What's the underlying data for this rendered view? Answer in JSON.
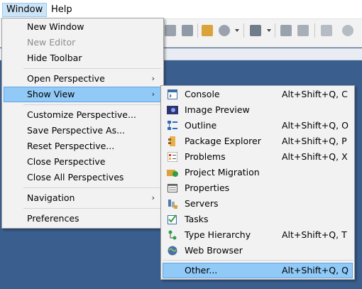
{
  "menubar": {
    "window": "Window",
    "help": "Help"
  },
  "window_menu": {
    "group1": [
      "New Window",
      "New Editor",
      "Hide Toolbar"
    ],
    "open_perspective": "Open Perspective",
    "show_view": "Show View",
    "group3": [
      "Customize Perspective...",
      "Save Perspective As...",
      "Reset Perspective...",
      "Close Perspective",
      "Close All Perspectives"
    ],
    "navigation": "Navigation",
    "preferences": "Preferences",
    "arrow": "›"
  },
  "show_view_menu": {
    "items": [
      {
        "label": "Console",
        "shortcut": "Alt+Shift+Q, C",
        "icon": "console-icon"
      },
      {
        "label": "Image Preview",
        "shortcut": "",
        "icon": "image-preview-icon"
      },
      {
        "label": "Outline",
        "shortcut": "Alt+Shift+Q, O",
        "icon": "outline-icon"
      },
      {
        "label": "Package Explorer",
        "shortcut": "Alt+Shift+Q, P",
        "icon": "package-explorer-icon"
      },
      {
        "label": "Problems",
        "shortcut": "Alt+Shift+Q, X",
        "icon": "problems-icon"
      },
      {
        "label": "Project Migration",
        "shortcut": "",
        "icon": "project-migration-icon"
      },
      {
        "label": "Properties",
        "shortcut": "",
        "icon": "properties-icon"
      },
      {
        "label": "Servers",
        "shortcut": "",
        "icon": "servers-icon"
      },
      {
        "label": "Tasks",
        "shortcut": "",
        "icon": "tasks-icon"
      },
      {
        "label": "Type Hierarchy",
        "shortcut": "Alt+Shift+Q, T",
        "icon": "type-hierarchy-icon"
      },
      {
        "label": "Web Browser",
        "shortcut": "",
        "icon": "web-browser-icon"
      }
    ],
    "other": {
      "label": "Other...",
      "shortcut": "Alt+Shift+Q, Q"
    }
  },
  "colors": {
    "highlight": "#91c9f7",
    "workbench": "#3a5f8f",
    "menu_bg": "#f2f2f2"
  }
}
